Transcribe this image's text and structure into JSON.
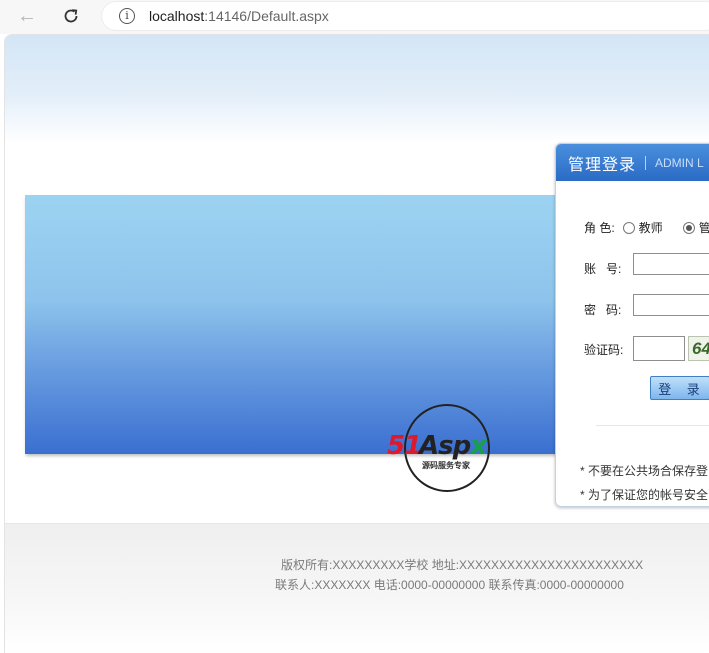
{
  "browser": {
    "url_host": "localhost",
    "url_path": ":14146/Default.aspx"
  },
  "logo": {
    "brand_51": "51",
    "brand_asp": "Asp",
    "brand_x": "x",
    "tagline": "源码服务专家"
  },
  "login": {
    "title": "管理登录",
    "subtitle": "ADMIN L",
    "role_label": "角 色:",
    "role_options": [
      "教师",
      "管"
    ],
    "role_selected": 1,
    "account_label": "账   号:",
    "password_label": "密   码:",
    "captcha_label": "验证码:",
    "captcha_text": "64",
    "submit_label": "登 录",
    "notices": [
      "* 不要在公共场合保存登",
      "* 为了保证您的帐号安全"
    ]
  },
  "footer": {
    "line1": "版权所有:XXXXXXXXX学校 地址:XXXXXXXXXXXXXXXXXXXXXXX",
    "line2": "联系人:XXXXXXX 电话:0000-00000000 联系传真:0000-00000000"
  }
}
